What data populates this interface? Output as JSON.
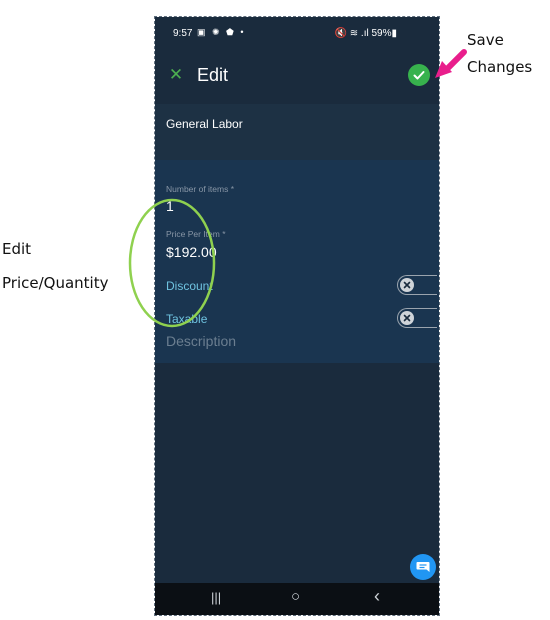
{
  "status_bar": {
    "time": "9:57",
    "notification_icons": "▣ ✺ ⬟ •",
    "right_icons": "🔇 ≋ .ıl 59%▮"
  },
  "app_bar": {
    "close_icon": "close-icon",
    "title": "Edit",
    "save_icon": "checkmark-icon"
  },
  "service": {
    "name": "General Labor"
  },
  "form": {
    "quantity_label": "Number of items *",
    "quantity_value": "1",
    "price_label": "Price Per Item *",
    "price_value": "$192.00",
    "discount_label": "Discount",
    "taxable_label": "Taxable",
    "description_placeholder": "Description"
  },
  "toggles": {
    "discount_on": false,
    "taxable_on": false
  },
  "chat_icon": "chat-icon",
  "nav": {
    "recents": "|||",
    "home": "○",
    "back": "‹"
  },
  "annotations": {
    "save_line1": "Save",
    "save_line2": "Changes",
    "edit_line1": "Edit",
    "edit_line2": "Price/Quantity"
  },
  "colors": {
    "background": "#1a2b3d",
    "accent_green": "#37b24d",
    "link_blue": "#6fc3e0",
    "annotation_arrow": "#e91e8c",
    "annotation_circle": "#8fd14f"
  }
}
